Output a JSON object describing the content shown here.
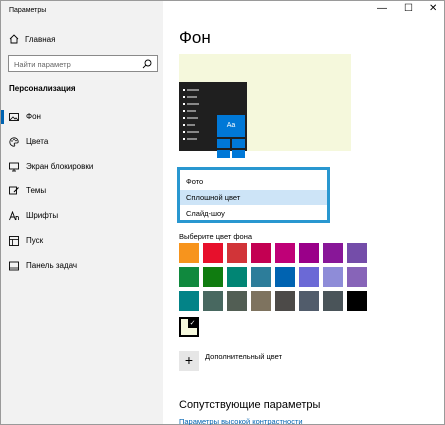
{
  "window": {
    "title": "Параметры",
    "minimize": "—",
    "maximize": "☐",
    "close": "✕"
  },
  "sidebar": {
    "home_label": "Главная",
    "search_placeholder": "Найти параметр",
    "section_title": "Персонализация",
    "items": [
      {
        "label": "Фон",
        "icon": "picture-icon",
        "active": true
      },
      {
        "label": "Цвета",
        "icon": "palette-icon",
        "active": false
      },
      {
        "label": "Экран блокировки",
        "icon": "monitor-icon",
        "active": false
      },
      {
        "label": "Темы",
        "icon": "brush-icon",
        "active": false
      },
      {
        "label": "Шрифты",
        "icon": "font-icon",
        "active": false
      },
      {
        "label": "Пуск",
        "icon": "start-icon",
        "active": false
      },
      {
        "label": "Панель задач",
        "icon": "taskbar-icon",
        "active": false
      }
    ]
  },
  "main": {
    "title": "Фон",
    "preview_tile_text": "Aa",
    "background_dropdown": {
      "options": [
        "Фото",
        "Сплошной цвет",
        "Слайд-шоу"
      ],
      "selected": "Сплошной цвет"
    },
    "color_label": "Выберите цвет фона",
    "colors": [
      "#f7941d",
      "#e7102c",
      "#d13438",
      "#c30052",
      "#bf0077",
      "#9a0089",
      "#881798",
      "#744da9",
      "#10893e",
      "#107c10",
      "#018574",
      "#2d7d9a",
      "#0063b1",
      "#6b69d6",
      "#8e8cd8",
      "#8764b8",
      "#038387",
      "#486860",
      "#525e54",
      "#7e735f",
      "#4c4a48",
      "#515c6b",
      "#4a5459",
      "#000000"
    ],
    "selected_color": "#f5f8dc",
    "add_color_label": "Дополнительный цвет",
    "related_title": "Сопутствующие параметры",
    "related_link": "Параметры высокой контрастности"
  },
  "accent_color": "#0063b1"
}
